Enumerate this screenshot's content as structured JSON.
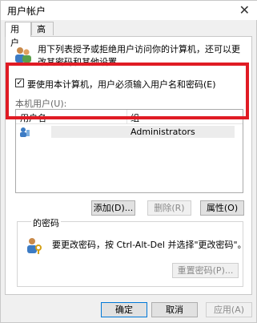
{
  "window": {
    "title": "用户帐户",
    "close_glyph": "✕"
  },
  "tabs": [
    "用户",
    "高级"
  ],
  "description": "用下列表授予或拒绝用户访问你的计算机，还可以更改其密码和其他设置。",
  "require_login": {
    "checked": true,
    "label": "要使用本计算机，用户必须输入用户名和密码(E)"
  },
  "users_section_label": "本机用户(U):",
  "table": {
    "headers": [
      "用户名",
      "组"
    ],
    "rows": [
      {
        "username": "",
        "group": "Administrators"
      }
    ]
  },
  "buttons": {
    "add": "添加(D)...",
    "remove": "删除(R)",
    "properties": "属性(O)"
  },
  "password_section": {
    "legend": "的密码",
    "text": "要更改密码，按 Ctrl-Alt-Del 并选择\"更改密码\"。",
    "reset_button": "重置密码(P)..."
  },
  "footer": {
    "ok": "确定",
    "cancel": "取消",
    "apply": "应用(A)"
  },
  "colors": {
    "highlight": "#e01b24",
    "accent": "#0078d7"
  }
}
